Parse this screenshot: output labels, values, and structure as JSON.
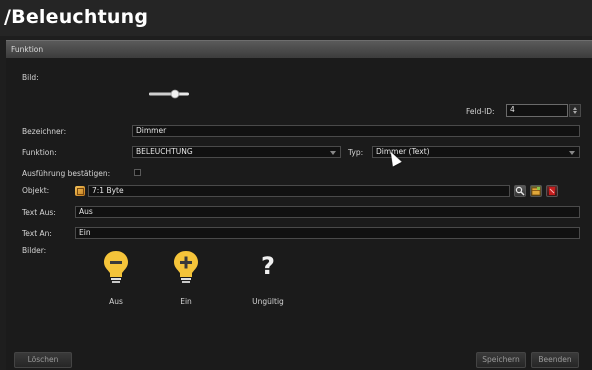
{
  "window": {
    "title": "/Beleuchtung"
  },
  "section": {
    "title": "Funktion"
  },
  "form": {
    "image_label": "Bild:",
    "field_id_label": "Feld-ID:",
    "field_id_value": "4",
    "name_label": "Bezeichner:",
    "name_value": "Dimmer",
    "function_label": "Funktion:",
    "function_value": "BELEUCHTUNG",
    "type_label": "Typ:",
    "type_value": "Dimmer (Text)",
    "confirm_label": "Ausführung bestätigen:",
    "confirm_checked": false,
    "object_label": "Objekt:",
    "object_value": "7:1 Byte",
    "text_off_label": "Text Aus:",
    "text_off_value": "Aus",
    "text_on_label": "Text An:",
    "text_on_value": "Ein",
    "images_label": "Bilder:",
    "images": [
      {
        "icon": "bulb-minus-icon",
        "caption": "Aus"
      },
      {
        "icon": "bulb-plus-icon",
        "caption": "Ein"
      },
      {
        "icon": "question-mark-icon",
        "caption": "Ungültig",
        "glyph": "?"
      }
    ]
  },
  "buttons": {
    "delete": "Löschen",
    "save": "Speichern",
    "close": "Beenden"
  },
  "colors": {
    "background": "#1e1e1e",
    "field_bg": "#111111",
    "bulb": "#f5c43a",
    "delete_tool": "#c41e1e"
  }
}
